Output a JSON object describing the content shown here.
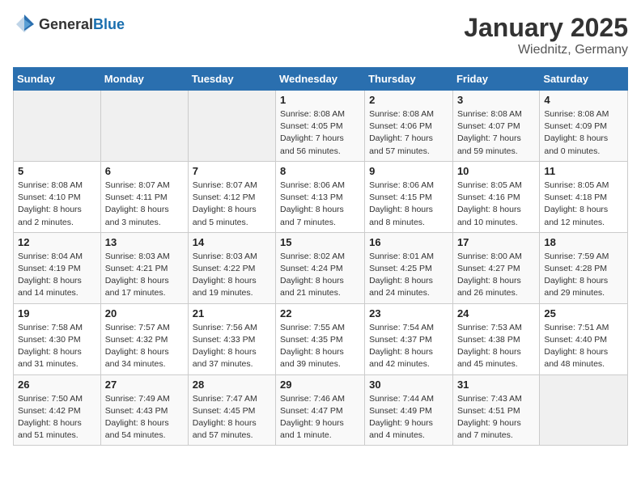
{
  "header": {
    "logo_general": "General",
    "logo_blue": "Blue",
    "month_year": "January 2025",
    "location": "Wiednitz, Germany"
  },
  "weekdays": [
    "Sunday",
    "Monday",
    "Tuesday",
    "Wednesday",
    "Thursday",
    "Friday",
    "Saturday"
  ],
  "weeks": [
    [
      {
        "day": "",
        "info": ""
      },
      {
        "day": "",
        "info": ""
      },
      {
        "day": "",
        "info": ""
      },
      {
        "day": "1",
        "info": "Sunrise: 8:08 AM\nSunset: 4:05 PM\nDaylight: 7 hours and 56 minutes."
      },
      {
        "day": "2",
        "info": "Sunrise: 8:08 AM\nSunset: 4:06 PM\nDaylight: 7 hours and 57 minutes."
      },
      {
        "day": "3",
        "info": "Sunrise: 8:08 AM\nSunset: 4:07 PM\nDaylight: 7 hours and 59 minutes."
      },
      {
        "day": "4",
        "info": "Sunrise: 8:08 AM\nSunset: 4:09 PM\nDaylight: 8 hours and 0 minutes."
      }
    ],
    [
      {
        "day": "5",
        "info": "Sunrise: 8:08 AM\nSunset: 4:10 PM\nDaylight: 8 hours and 2 minutes."
      },
      {
        "day": "6",
        "info": "Sunrise: 8:07 AM\nSunset: 4:11 PM\nDaylight: 8 hours and 3 minutes."
      },
      {
        "day": "7",
        "info": "Sunrise: 8:07 AM\nSunset: 4:12 PM\nDaylight: 8 hours and 5 minutes."
      },
      {
        "day": "8",
        "info": "Sunrise: 8:06 AM\nSunset: 4:13 PM\nDaylight: 8 hours and 7 minutes."
      },
      {
        "day": "9",
        "info": "Sunrise: 8:06 AM\nSunset: 4:15 PM\nDaylight: 8 hours and 8 minutes."
      },
      {
        "day": "10",
        "info": "Sunrise: 8:05 AM\nSunset: 4:16 PM\nDaylight: 8 hours and 10 minutes."
      },
      {
        "day": "11",
        "info": "Sunrise: 8:05 AM\nSunset: 4:18 PM\nDaylight: 8 hours and 12 minutes."
      }
    ],
    [
      {
        "day": "12",
        "info": "Sunrise: 8:04 AM\nSunset: 4:19 PM\nDaylight: 8 hours and 14 minutes."
      },
      {
        "day": "13",
        "info": "Sunrise: 8:03 AM\nSunset: 4:21 PM\nDaylight: 8 hours and 17 minutes."
      },
      {
        "day": "14",
        "info": "Sunrise: 8:03 AM\nSunset: 4:22 PM\nDaylight: 8 hours and 19 minutes."
      },
      {
        "day": "15",
        "info": "Sunrise: 8:02 AM\nSunset: 4:24 PM\nDaylight: 8 hours and 21 minutes."
      },
      {
        "day": "16",
        "info": "Sunrise: 8:01 AM\nSunset: 4:25 PM\nDaylight: 8 hours and 24 minutes."
      },
      {
        "day": "17",
        "info": "Sunrise: 8:00 AM\nSunset: 4:27 PM\nDaylight: 8 hours and 26 minutes."
      },
      {
        "day": "18",
        "info": "Sunrise: 7:59 AM\nSunset: 4:28 PM\nDaylight: 8 hours and 29 minutes."
      }
    ],
    [
      {
        "day": "19",
        "info": "Sunrise: 7:58 AM\nSunset: 4:30 PM\nDaylight: 8 hours and 31 minutes."
      },
      {
        "day": "20",
        "info": "Sunrise: 7:57 AM\nSunset: 4:32 PM\nDaylight: 8 hours and 34 minutes."
      },
      {
        "day": "21",
        "info": "Sunrise: 7:56 AM\nSunset: 4:33 PM\nDaylight: 8 hours and 37 minutes."
      },
      {
        "day": "22",
        "info": "Sunrise: 7:55 AM\nSunset: 4:35 PM\nDaylight: 8 hours and 39 minutes."
      },
      {
        "day": "23",
        "info": "Sunrise: 7:54 AM\nSunset: 4:37 PM\nDaylight: 8 hours and 42 minutes."
      },
      {
        "day": "24",
        "info": "Sunrise: 7:53 AM\nSunset: 4:38 PM\nDaylight: 8 hours and 45 minutes."
      },
      {
        "day": "25",
        "info": "Sunrise: 7:51 AM\nSunset: 4:40 PM\nDaylight: 8 hours and 48 minutes."
      }
    ],
    [
      {
        "day": "26",
        "info": "Sunrise: 7:50 AM\nSunset: 4:42 PM\nDaylight: 8 hours and 51 minutes."
      },
      {
        "day": "27",
        "info": "Sunrise: 7:49 AM\nSunset: 4:43 PM\nDaylight: 8 hours and 54 minutes."
      },
      {
        "day": "28",
        "info": "Sunrise: 7:47 AM\nSunset: 4:45 PM\nDaylight: 8 hours and 57 minutes."
      },
      {
        "day": "29",
        "info": "Sunrise: 7:46 AM\nSunset: 4:47 PM\nDaylight: 9 hours and 1 minute."
      },
      {
        "day": "30",
        "info": "Sunrise: 7:44 AM\nSunset: 4:49 PM\nDaylight: 9 hours and 4 minutes."
      },
      {
        "day": "31",
        "info": "Sunrise: 7:43 AM\nSunset: 4:51 PM\nDaylight: 9 hours and 7 minutes."
      },
      {
        "day": "",
        "info": ""
      }
    ]
  ]
}
